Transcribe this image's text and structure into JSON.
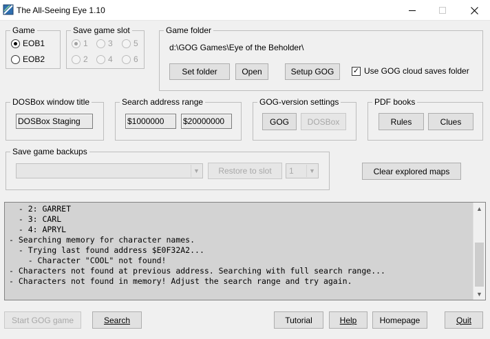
{
  "window": {
    "title": "The All-Seeing Eye 1.10",
    "icon": "eye-app-icon"
  },
  "game_group": {
    "label": "Game",
    "options": [
      {
        "label": "EOB1",
        "checked": true
      },
      {
        "label": "EOB2",
        "checked": false
      }
    ]
  },
  "slot_group": {
    "label": "Save game slot",
    "options": [
      {
        "label": "1",
        "checked": true
      },
      {
        "label": "2",
        "checked": false
      },
      {
        "label": "3",
        "checked": false
      },
      {
        "label": "4",
        "checked": false
      },
      {
        "label": "5",
        "checked": false
      },
      {
        "label": "6",
        "checked": false
      }
    ]
  },
  "folder_group": {
    "label": "Game folder",
    "path": "d:\\GOG Games\\Eye of the Beholder\\",
    "set_folder": "Set folder",
    "open": "Open",
    "setup_gog": "Setup GOG",
    "cloud_checkbox_label": "Use GOG cloud saves folder",
    "cloud_checked": true
  },
  "dosbox_group": {
    "label": "DOSBox window title",
    "value": "DOSBox Staging"
  },
  "search_range_group": {
    "label": "Search address range",
    "start": "$1000000",
    "end": "$20000000"
  },
  "gog_settings_group": {
    "label": "GOG-version settings",
    "gog": "GOG",
    "dosbox": "DOSBox"
  },
  "pdf_group": {
    "label": "PDF books",
    "rules": "Rules",
    "clues": "Clues"
  },
  "backups_group": {
    "label": "Save game backups",
    "backup_value": "",
    "restore": "Restore to slot",
    "slot_value": "1"
  },
  "clear_maps": "Clear explored maps",
  "log": {
    "lines": [
      "  - 2: GARRET",
      "  - 3: CARL",
      "  - 4: APRYL",
      "- Searching memory for character names.",
      "  - Trying last found address $E0F32A2...",
      "    - Character \"COOL\" not found!",
      "- Characters not found at previous address. Searching with full search range...",
      "- Characters not found in memory! Adjust the search range and try again."
    ]
  },
  "bottom": {
    "start_gog": "Start GOG game",
    "search": "Search",
    "tutorial": "Tutorial",
    "help": "Help",
    "homepage": "Homepage",
    "quit": "Quit"
  }
}
